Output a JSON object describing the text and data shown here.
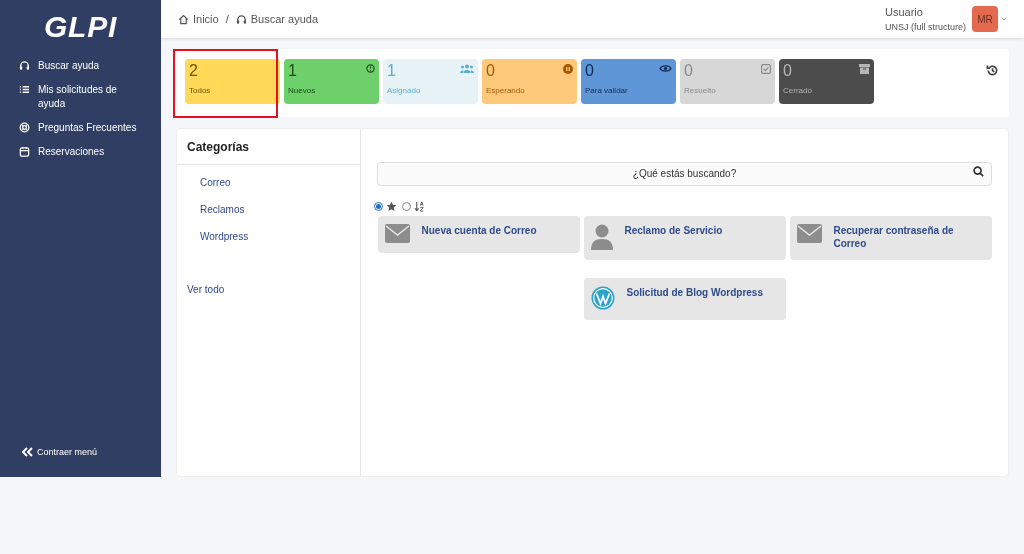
{
  "sidebar": {
    "logo": "GLPI",
    "items": [
      {
        "label": "Buscar ayuda",
        "kind": "headset"
      },
      {
        "label": "Mis solicitudes de ayuda",
        "kind": "list"
      },
      {
        "label": "Preguntas Frecuentes",
        "kind": "lifebuoy"
      },
      {
        "label": "Reservaciones",
        "kind": "calendar"
      }
    ],
    "collapse": "Contraer menú"
  },
  "breadcrumb": {
    "separator": "/",
    "items": [
      {
        "label": "Inicio",
        "kind": "home"
      },
      {
        "label": "Buscar ayuda",
        "kind": "headset"
      }
    ]
  },
  "user": {
    "name": "Usuario",
    "entity": "UNSJ (full structure)",
    "initials": "MR"
  },
  "tiles": [
    {
      "count": "2",
      "label": "Todos",
      "color": "#ffd957",
      "kind": "all",
      "highlighted": true
    },
    {
      "count": "1",
      "label": "Nuevos",
      "color": "#6dd06b",
      "kind": "new",
      "highlighted": false
    },
    {
      "count": "1",
      "label": "Asignado",
      "color": "#e6f2f6",
      "kind": "assigned",
      "highlighted": false
    },
    {
      "count": "0",
      "label": "Esperando",
      "color": "#ffc97c",
      "kind": "waiting",
      "highlighted": false
    },
    {
      "count": "0",
      "label": "Para validar",
      "color": "#5f96d8",
      "kind": "validate",
      "highlighted": false
    },
    {
      "count": "0",
      "label": "Resuelto",
      "color": "#d7d7d7",
      "kind": "solved",
      "highlighted": false
    },
    {
      "count": "0",
      "label": "Cerrado",
      "color": "#4c4c4c",
      "kind": "closed",
      "highlighted": false
    }
  ],
  "categories": {
    "title": "Categorías",
    "items": [
      "Correo",
      "Reclamos",
      "Wordpress"
    ],
    "all": "Ver todo"
  },
  "search": {
    "placeholder": "¿Qué estás buscando?"
  },
  "sort_options": [
    {
      "kind": "star",
      "selected": true
    },
    {
      "kind": "alpha",
      "selected": false
    }
  ],
  "forms": [
    {
      "title": "Nueva cuenta de Correo",
      "kind": "mail"
    },
    {
      "title": "Reclamo de Servicio",
      "kind": "complaint"
    },
    {
      "title": "Recuperar contraseña de Correo",
      "kind": "mail"
    },
    {
      "title": "Solicitud de Blog Wordpress",
      "kind": "blog"
    }
  ]
}
